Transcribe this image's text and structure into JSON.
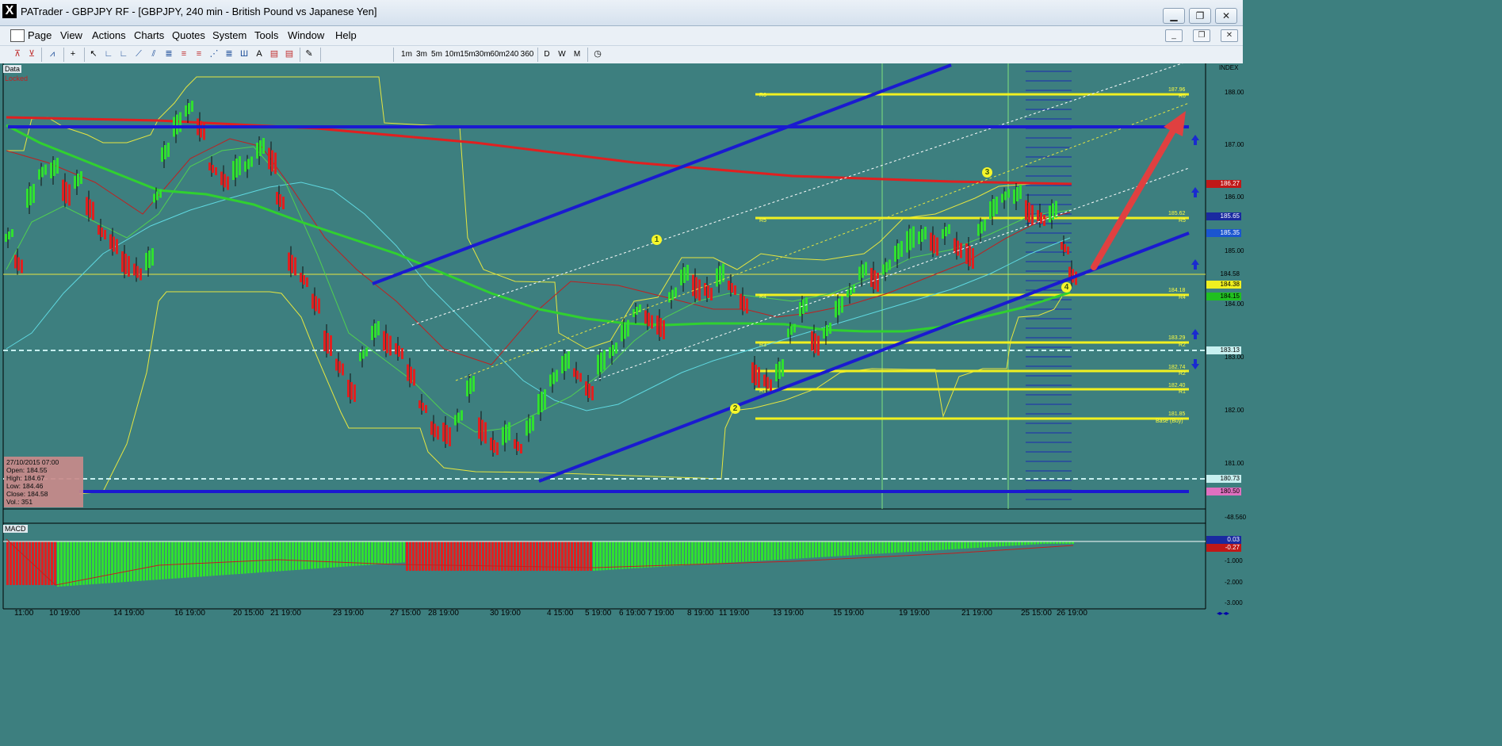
{
  "window": {
    "title": "PATrader - GBPJPY RF - [GBPJPY, 240 min - British Pound vs Japanese Yen]",
    "app_icon": "X",
    "controls": [
      "minimize-icon",
      "restore-icon",
      "close-icon"
    ]
  },
  "menu": {
    "items": [
      "Page",
      "View",
      "Actions",
      "Charts",
      "Quotes",
      "System",
      "Tools",
      "Window",
      "Help"
    ],
    "mdi_controls": [
      "minimize-icon",
      "restore-icon",
      "close-icon"
    ]
  },
  "toolbar": {
    "timeframes": [
      "1m",
      "3m",
      "5m",
      "10m",
      "15m",
      "30m",
      "60m",
      "240",
      "360"
    ],
    "periods": [
      "D",
      "W",
      "M"
    ]
  },
  "panel": {
    "data_label": "Data",
    "locked_label": "Locked",
    "macd_label": "MACD",
    "index_label": "INDEX"
  },
  "ohlc": {
    "date": "27/10/2015 07:00",
    "open": "Open: 184.55",
    "high": "High: 184.67",
    "low": "Low: 184.46",
    "close": "Close: 184.58",
    "vol": "Vol.: 351"
  },
  "price_axis": [
    "188.00",
    "187.00",
    "186.00",
    "185.00",
    "184.00",
    "183.00",
    "182.00",
    "181.00"
  ],
  "price_tags": [
    {
      "value": "186.27",
      "bg": "#c01818",
      "fg": "#ffffff"
    },
    {
      "value": "185.65",
      "bg": "#1a2aa0",
      "fg": "#ffffff"
    },
    {
      "value": "185.35",
      "bg": "#1a55d0",
      "fg": "#ffffff"
    },
    {
      "value": "184.58",
      "bg": "#3d7f7f",
      "fg": "#000000"
    },
    {
      "value": "184.38",
      "bg": "#f0f020",
      "fg": "#000000"
    },
    {
      "value": "184.15",
      "bg": "#20c020",
      "fg": "#000000"
    },
    {
      "value": "183.13",
      "bg": "#c8f0f0",
      "fg": "#000000"
    },
    {
      "value": "180.73",
      "bg": "#c8f0f0",
      "fg": "#000000"
    },
    {
      "value": "180.50",
      "bg": "#e070c0",
      "fg": "#000000"
    }
  ],
  "macd_axis": [
    "-48.560",
    "-1.000",
    "-2.000",
    "-3.000"
  ],
  "macd_tags": [
    {
      "value": "0.03",
      "bg": "#1a2aa0",
      "fg": "#ffffff"
    },
    {
      "value": "-0.27",
      "bg": "#c01818",
      "fg": "#ffffff"
    }
  ],
  "time_axis": [
    "11:00",
    "10 19:00",
    "14 19:00",
    "16 19:00",
    "20 15:00",
    "21 19:00",
    "23 19:00",
    "27 15:00",
    "28 19:00",
    "30 19:00",
    "4 15:00",
    "5 19:00",
    "6 19:00",
    "7 19:00",
    "8 19:00",
    "11 19:00",
    "13 19:00",
    "15 19:00",
    "19 19:00",
    "21 19:00",
    "25 15:00",
    "26 19:00"
  ],
  "pivots": [
    {
      "level": "R6",
      "value": "187.96"
    },
    {
      "level": "R5",
      "value": "185.62"
    },
    {
      "level": "R4",
      "value": "184.18"
    },
    {
      "level": "R3",
      "value": ""
    },
    {
      "level": "R2",
      "value": "183.29"
    },
    {
      "level": "R2",
      "value": "182.74"
    },
    {
      "level": "R1",
      "value": "182.40"
    },
    {
      "level": "Base (Buy)",
      "value": "181.85"
    }
  ],
  "waves": [
    "1",
    "2",
    "3",
    "4"
  ]
}
